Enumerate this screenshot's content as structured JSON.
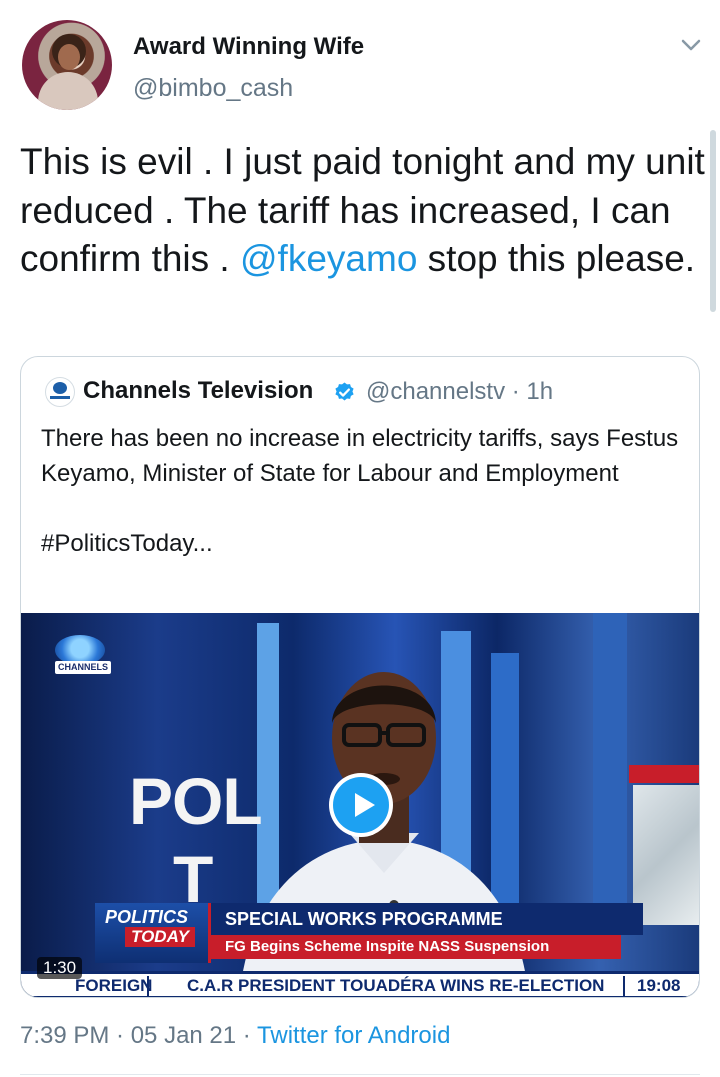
{
  "author": {
    "display_name": "Award Winning Wife",
    "handle": "@bimbo_cash"
  },
  "tweet": {
    "text_before": "This is evil . I just paid tonight and my unit reduced . The tariff has increased, I can confirm this . ",
    "mention": "@fkeyamo",
    "text_after": " stop this please."
  },
  "quoted_tweet": {
    "name": "Channels Television",
    "handle_time": "@channelstv · 1h",
    "text_line1": "There has been no increase in electricity tariffs, says Festus Keyamo, Minister of State for Labour and Employment",
    "hashtag_line": "#PoliticsToday..."
  },
  "video": {
    "channel_tag": "CHANNELS",
    "bg_word1": "POL",
    "bg_word2": "T",
    "lower_third_logo_top": "POLITICS",
    "lower_third_logo_bottom": "TODAY",
    "headline": "SPECIAL WORKS PROGRAMME",
    "subheadline": "FG Begins Scheme Inspite NASS Suspension",
    "ticker_label": "FOREIGN",
    "ticker_text": "C.A.R PRESIDENT TOUADÉRA WINS RE-ELECTION",
    "ticker_time": "19:08",
    "duration": "1:30"
  },
  "meta": {
    "timestamp": "7:39 PM · 05 Jan 21 · ",
    "source": "Twitter for Android"
  },
  "colors": {
    "link": "#1b95e0",
    "secondary_text": "#657786",
    "verified": "#1da1f2"
  }
}
